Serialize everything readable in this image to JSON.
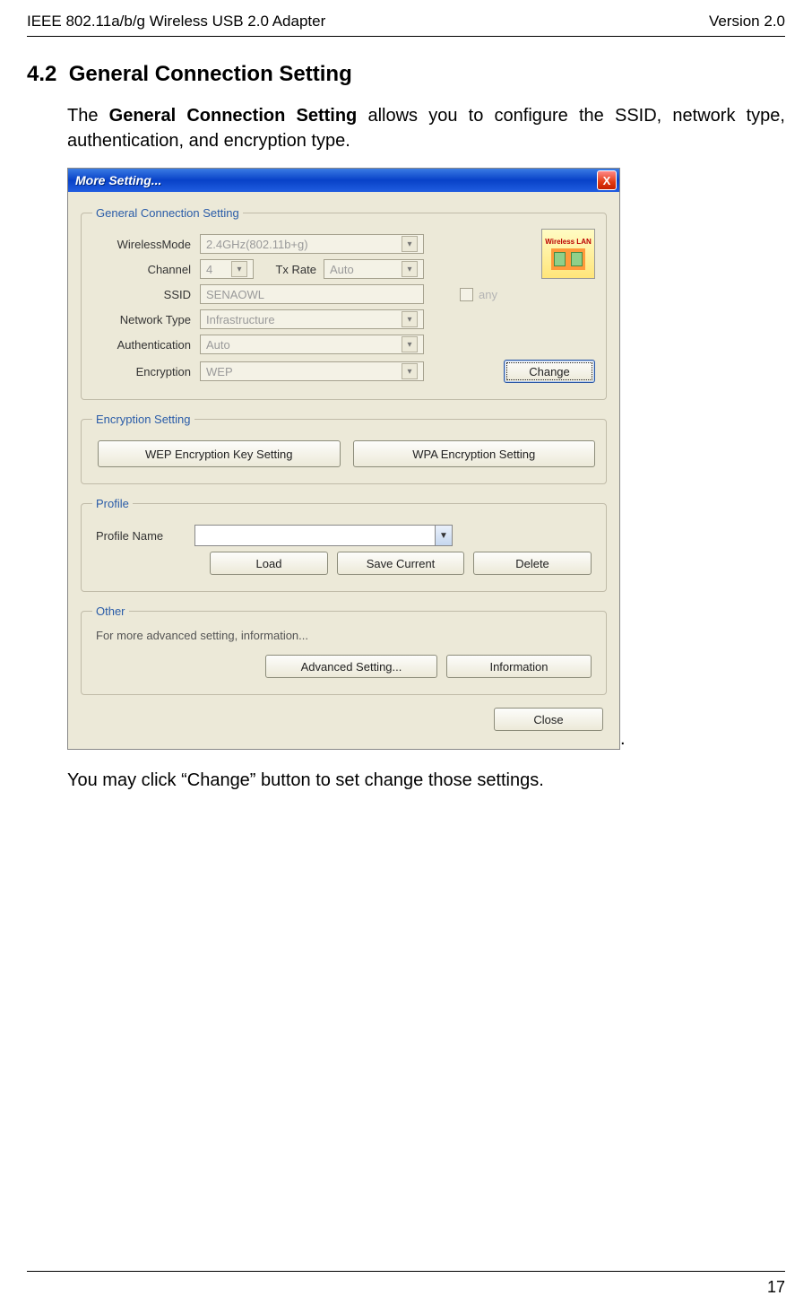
{
  "header": {
    "left": "IEEE 802.11a/b/g Wireless USB 2.0 Adapter",
    "right": "Version 2.0"
  },
  "section": {
    "number": "4.2",
    "title": "General Connection Setting"
  },
  "para1_prefix": "The ",
  "para1_bold": "General Connection Setting",
  "para1_suffix": " allows you to configure the SSID, network type, authentication, and encryption type.",
  "para2": "You may click “Change” button to set change those settings.",
  "page_number": "17",
  "dialog": {
    "title": "More Setting...",
    "close_x": "X",
    "logo": "Wireless LAN",
    "groups": {
      "gcs": {
        "legend": "General Connection Setting",
        "wirelessmode_lbl": "WirelessMode",
        "wirelessmode_val": "2.4GHz(802.11b+g)",
        "channel_lbl": "Channel",
        "channel_val": "4",
        "txrate_lbl": "Tx Rate",
        "txrate_val": "Auto",
        "ssid_lbl": "SSID",
        "ssid_val": "SENAOWL",
        "any_lbl": "any",
        "nettype_lbl": "Network Type",
        "nettype_val": "Infrastructure",
        "auth_lbl": "Authentication",
        "auth_val": "Auto",
        "enc_lbl": "Encryption",
        "enc_val": "WEP",
        "change_btn": "Change"
      },
      "encset": {
        "legend": "Encryption Setting",
        "wep_btn": "WEP Encryption Key Setting",
        "wpa_btn": "WPA Encryption Setting"
      },
      "profile": {
        "legend": "Profile",
        "name_lbl": "Profile Name",
        "name_val": "",
        "load_btn": "Load",
        "save_btn": "Save Current",
        "delete_btn": "Delete"
      },
      "other": {
        "legend": "Other",
        "hint": "For more advanced setting, information...",
        "adv_btn": "Advanced Setting...",
        "info_btn": "Information"
      }
    },
    "close_btn": "Close"
  }
}
